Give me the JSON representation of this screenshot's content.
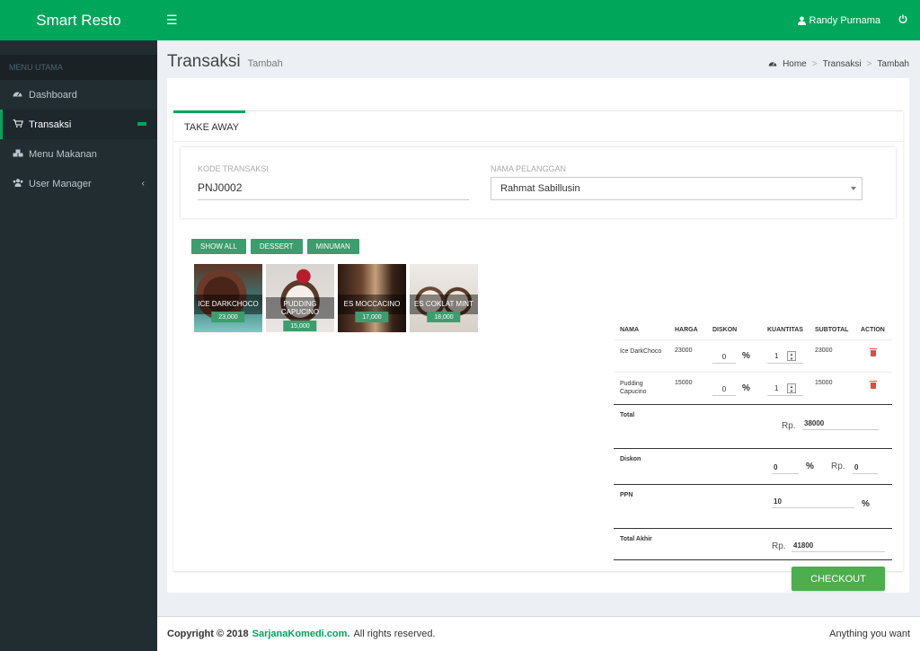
{
  "header": {
    "app_title": "Smart Resto",
    "user_name": "Randy Purnama"
  },
  "sidebar": {
    "section_label": "MENU UTAMA",
    "items": [
      {
        "label": "Dashboard"
      },
      {
        "label": "Transaksi"
      },
      {
        "label": "Menu Makanan"
      },
      {
        "label": "User Manager"
      }
    ]
  },
  "page": {
    "title": "Transaksi",
    "subtitle": "Tambah",
    "breadcrumb": [
      "Home",
      "Transaksi",
      "Tambah"
    ]
  },
  "tab": {
    "label": "TAKE AWAY"
  },
  "form": {
    "kode_label": "KODE TRANSAKSI",
    "kode_value": "PNJ0002",
    "pelanggan_label": "NAMA PELANGGAN",
    "pelanggan_value": "Rahmat Sabillusin"
  },
  "filters": [
    "SHOW ALL",
    "DESSERT",
    "MINUMAN"
  ],
  "products": [
    {
      "name": "ICE DARKCHOCO",
      "price": "23,000"
    },
    {
      "name": "PUDDING CAPUCINO",
      "price": "15,000"
    },
    {
      "name": "ES MOCCACINO",
      "price": "17,000"
    },
    {
      "name": "ES COKLAT MINT",
      "price": "18,000"
    }
  ],
  "order": {
    "columns": [
      "NAMA",
      "HARGA",
      "DISKON",
      "KUANTITAS",
      "SUBTOTAL",
      "ACTION"
    ],
    "rows": [
      {
        "nama": "Ice DarkChoco",
        "harga": "23000",
        "diskon": "0",
        "qty": "1",
        "subtotal": "23000"
      },
      {
        "nama": "Pudding Capucino",
        "harga": "15000",
        "diskon": "0",
        "qty": "1",
        "subtotal": "15000"
      }
    ],
    "pct": "%",
    "rp": "Rp.",
    "total_label": "Total",
    "total_value": "38000",
    "diskon_label": "Diskon",
    "diskon_pct": "0",
    "diskon_rp": "0",
    "ppn_label": "PPN",
    "ppn_value": "10",
    "total_akhir_label": "Total Akhir",
    "total_akhir_value": "41800"
  },
  "checkout_label": "CHECKOUT",
  "footer": {
    "copy": "Copyright © 2018",
    "brand": "SarjanaKomedi.com.",
    "rights": "All rights reserved.",
    "right": "Anything you want"
  }
}
